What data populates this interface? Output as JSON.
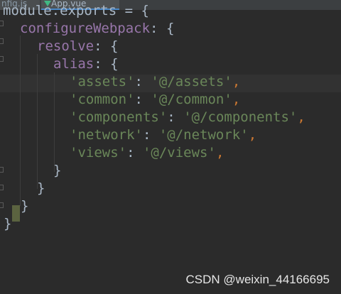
{
  "tabs": [
    {
      "label": "nfig.js"
    },
    {
      "label": "App.vue"
    }
  ],
  "code": {
    "line0": "module.exports = {",
    "configure_key": "configureWebpack",
    "resolve_key": "resolve",
    "alias_key": "alias",
    "aliases": [
      {
        "key": "'assets'",
        "value": "'@/assets'",
        "trail": ","
      },
      {
        "key": "'common'",
        "value": "'@/common'",
        "trail": ","
      },
      {
        "key": "'components'",
        "value": "'@/components'",
        "trail": ","
      },
      {
        "key": "'network'",
        "value": "'@/network'",
        "trail": ","
      },
      {
        "key": "'views'",
        "value": "'@/views'",
        "trail": ","
      }
    ],
    "colon": ":",
    "open_brace": "{",
    "close_brace": "}"
  },
  "watermark": "CSDN @weixin_44166695",
  "colors": {
    "background": "#2b2b2b",
    "string": "#6a8759",
    "property": "#9876aa",
    "keyword": "#cc7832",
    "plain": "#a9b7c6"
  }
}
